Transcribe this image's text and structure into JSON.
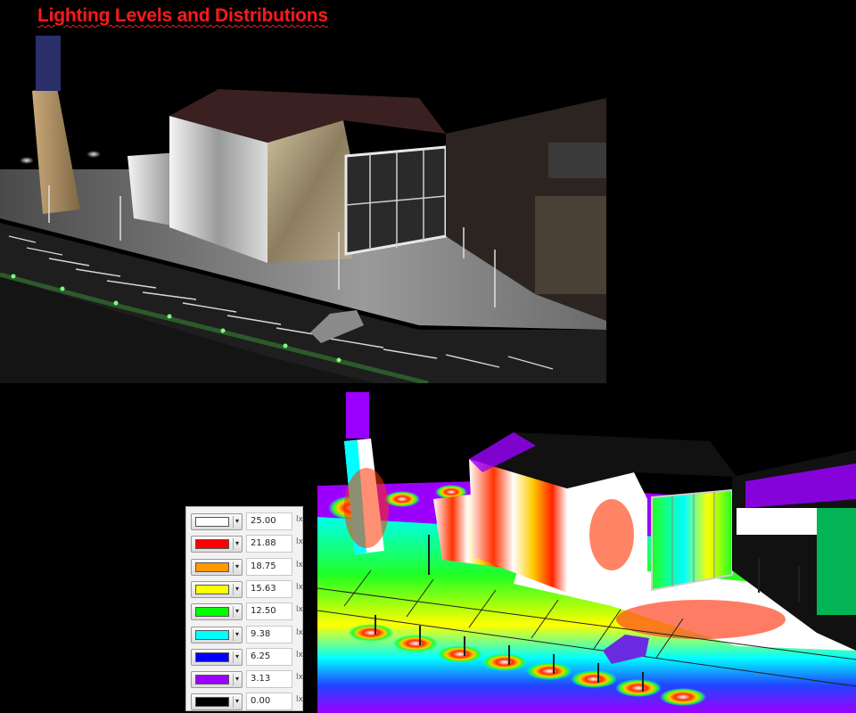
{
  "title": "Lighting Levels and Distributions",
  "legend": {
    "unit": "lx",
    "levels": [
      {
        "value": "25.00",
        "color": "#ffffff"
      },
      {
        "value": "21.88",
        "color": "#ff0000"
      },
      {
        "value": "18.75",
        "color": "#ff9900"
      },
      {
        "value": "15.63",
        "color": "#ffff00"
      },
      {
        "value": "12.50",
        "color": "#00ff00"
      },
      {
        "value": "9.38",
        "color": "#00ffff"
      },
      {
        "value": "6.25",
        "color": "#0000ff"
      },
      {
        "value": "3.13",
        "color": "#9900ff"
      },
      {
        "value": "0.00",
        "color": "#000000"
      }
    ]
  }
}
